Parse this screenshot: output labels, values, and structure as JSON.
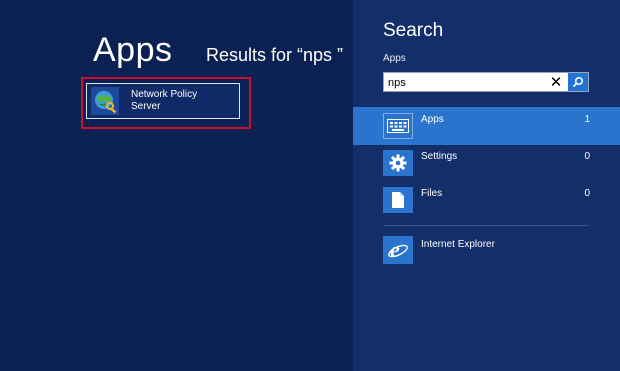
{
  "apps_title": "Apps",
  "results_for": "Results for “nps ”",
  "results": [
    {
      "label_line1": "Network Policy",
      "label_line2": "Server",
      "icon": "network-policy-server-icon"
    }
  ],
  "search_pane": {
    "heading": "Search",
    "scope": "Apps",
    "query": "nps",
    "filters": [
      {
        "label": "Apps",
        "count": "1",
        "icon": "apps-keyboard-icon",
        "selected": true
      },
      {
        "label": "Settings",
        "count": "0",
        "icon": "gear-icon",
        "selected": false
      },
      {
        "label": "Files",
        "count": "0",
        "icon": "file-icon",
        "selected": false
      }
    ],
    "extra_results": [
      {
        "label": "Internet Explorer",
        "icon": "internet-explorer-icon"
      }
    ]
  },
  "colors": {
    "background": "#0b2153",
    "pane": "#132f69",
    "accent": "#2a74cd",
    "highlight_border": "#c8102e"
  }
}
